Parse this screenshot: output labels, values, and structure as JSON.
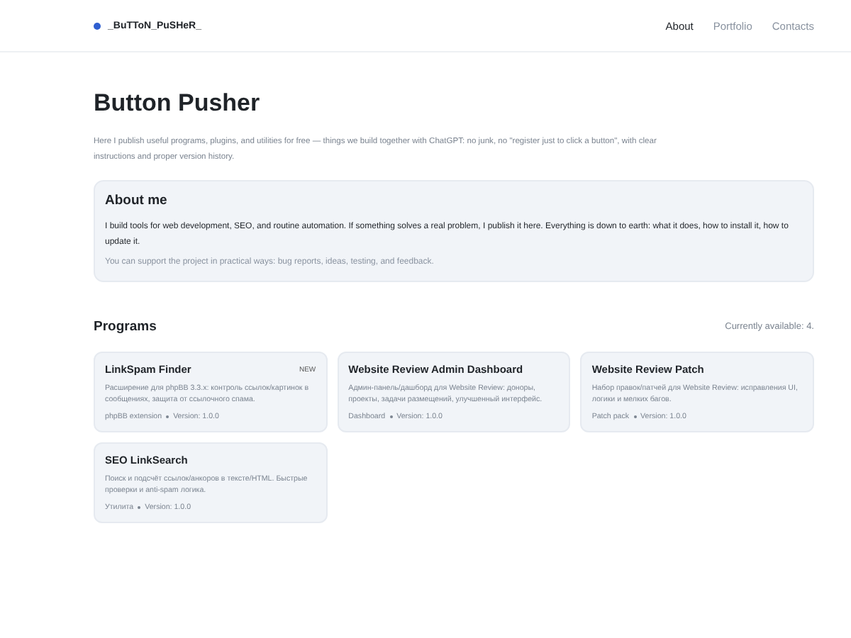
{
  "header": {
    "logo": "_BuTToN_PuSHeR_",
    "nav": [
      {
        "label": "About",
        "selected": true
      },
      {
        "label": "Portfolio",
        "selected": false
      },
      {
        "label": "Contacts",
        "selected": false
      }
    ]
  },
  "hero": {
    "title": "Button Pusher",
    "intro": "Here I publish useful programs, plugins, and utilities for free — things we build together with ChatGPT: no junk, no \"register just to click a button\", with clear instructions and proper version history."
  },
  "about": {
    "title": "About me",
    "text": "I build tools for web development, SEO, and routine automation. If something solves a real problem, I publish it here. Everything is down to earth: what it does, how to install it, how to update it.",
    "note": "You can support the project in practical ways: bug reports, ideas, testing, and feedback."
  },
  "programs": {
    "title": "Programs",
    "count": "Currently available: 4.",
    "items": [
      {
        "name": "LinkSpam Finder",
        "badge": "NEW",
        "description": "Расширение для phpBB 3.3.x: контроль ссылок/картинок в сообщениях, защита от ссылочного спама.",
        "type": "phpBB extension",
        "version": "Version: 1.0.0"
      },
      {
        "name": "Website Review Admin Dashboard",
        "description": "Админ-панель/дашборд для Website Review: доноры, проекты, задачи размещений, улучшенный интерфейс.",
        "type": "Dashboard",
        "version": "Version: 1.0.0"
      },
      {
        "name": "Website Review Patch",
        "description": "Набор правок/патчей для Website Review: исправления UI, логики и мелких багов.",
        "type": "Patch pack",
        "version": "Version: 1.0.0"
      },
      {
        "name": "SEO LinkSearch",
        "description": "Поиск и подсчёт ссылок/анкоров в тексте/HTML. Быстрые проверки и anti-spam логика.",
        "type": "Утилита",
        "version": "Version: 1.0.0"
      }
    ]
  }
}
